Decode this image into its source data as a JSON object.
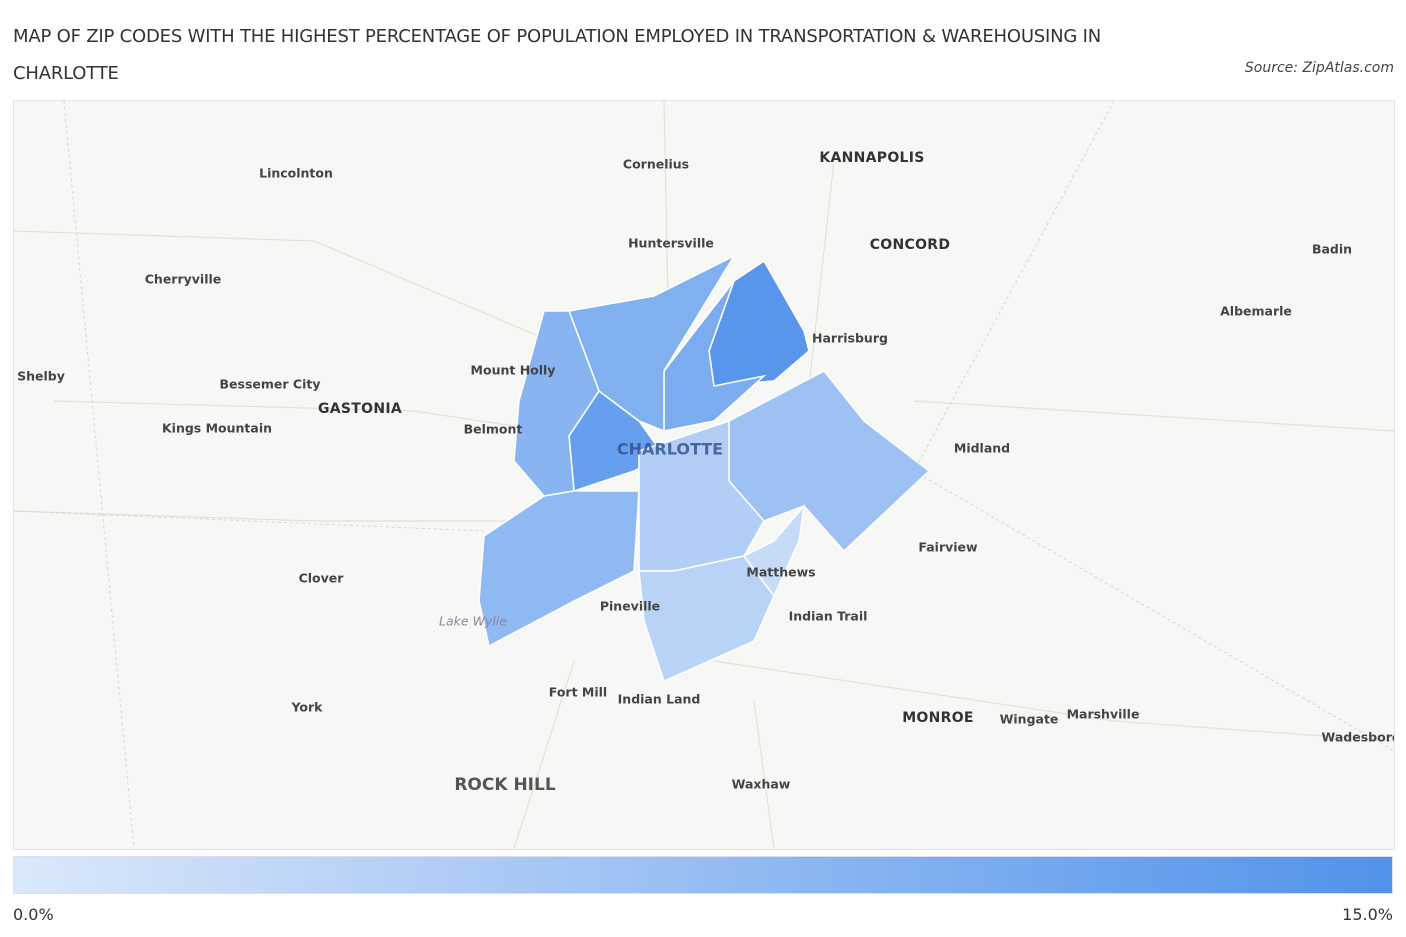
{
  "title": "MAP OF ZIP CODES WITH THE HIGHEST PERCENTAGE OF POPULATION EMPLOYED IN TRANSPORTATION & WAREHOUSING IN CHARLOTTE",
  "source": "Source: ZipAtlas.com",
  "legend": {
    "min_label": "0.0%",
    "max_label": "15.0%",
    "min_color": "#dbe8fb",
    "max_color": "#5192ea"
  },
  "places": [
    {
      "name": "Cornelius"
    },
    {
      "name": "KANNAPOLIS"
    },
    {
      "name": "Lincolnton"
    },
    {
      "name": "Huntersville"
    },
    {
      "name": "CONCORD"
    },
    {
      "name": "Badin"
    },
    {
      "name": "Cherryville"
    },
    {
      "name": "Albemarle"
    },
    {
      "name": "Harrisburg"
    },
    {
      "name": "Shelby"
    },
    {
      "name": "Mount Holly"
    },
    {
      "name": "Bessemer City"
    },
    {
      "name": "GASTONIA"
    },
    {
      "name": "Kings Mountain"
    },
    {
      "name": "Belmont"
    },
    {
      "name": "CHARLOTTE"
    },
    {
      "name": "Midland"
    },
    {
      "name": "Fairview"
    },
    {
      "name": "Matthews"
    },
    {
      "name": "Clover"
    },
    {
      "name": "Pineville"
    },
    {
      "name": "Indian Trail"
    },
    {
      "name": "Lake Wylie"
    },
    {
      "name": "Fort Mill"
    },
    {
      "name": "Indian Land"
    },
    {
      "name": "York"
    },
    {
      "name": "MONROE"
    },
    {
      "name": "Wingate"
    },
    {
      "name": "Marshville"
    },
    {
      "name": "Wadesboro"
    },
    {
      "name": "ROCK HILL"
    },
    {
      "name": "Waxhaw"
    }
  ],
  "zip_regions_relative_values": [
    {
      "area": "north-east",
      "level": 0.95
    },
    {
      "area": "west-central",
      "level": 0.85
    },
    {
      "area": "north",
      "level": 0.7
    },
    {
      "area": "north-west",
      "level": 0.65
    },
    {
      "area": "west",
      "level": 0.6
    },
    {
      "area": "south-west",
      "level": 0.55
    },
    {
      "area": "east",
      "level": 0.45
    },
    {
      "area": "south-central",
      "level": 0.3
    },
    {
      "area": "south",
      "level": 0.25
    },
    {
      "area": "south-east",
      "level": 0.15
    }
  ]
}
